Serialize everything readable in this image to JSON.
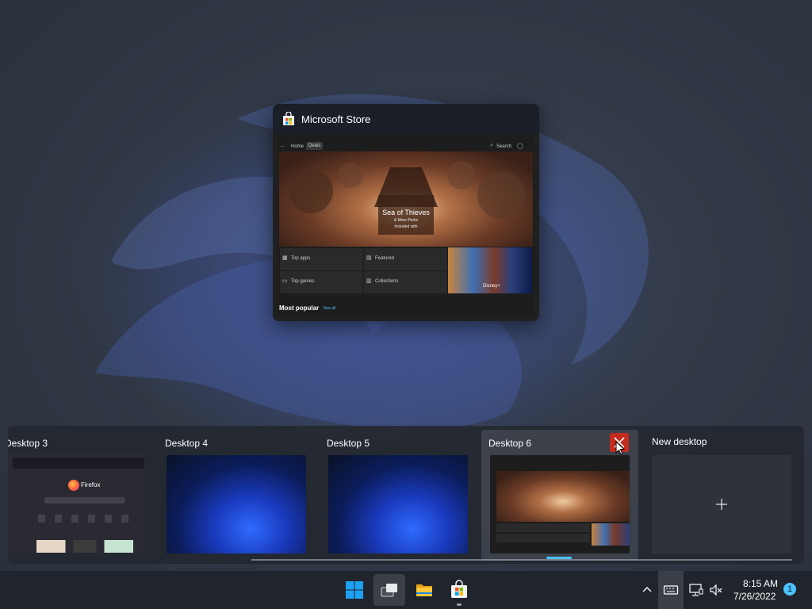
{
  "window": {
    "title": "Microsoft Store",
    "app_icon": "store-bag-icon",
    "preview": {
      "nav_home": "Home",
      "nav_deals": "Deals",
      "search": "Search",
      "hero_title": "Sea of Thieves",
      "hero_subtitle": "& More Perks",
      "hero_note": "Included with",
      "tiles": [
        "Top apps",
        "Featured",
        "Top games",
        "Collections"
      ],
      "promo_label": "Disney+",
      "section_title": "Most popular",
      "section_link": "See all"
    }
  },
  "desktops": {
    "items": [
      {
        "label": "Desktop 3",
        "thumb": "firefox-window",
        "app_title": "Firefox"
      },
      {
        "label": "Desktop 4",
        "thumb": "wallpaper"
      },
      {
        "label": "Desktop 5",
        "thumb": "wallpaper"
      },
      {
        "label": "Desktop 6",
        "thumb": "store-window",
        "active": true
      }
    ],
    "new_desktop_label": "New desktop",
    "new_desktop_icon": "plus-icon",
    "close_icon": "close-icon"
  },
  "taskbar": {
    "apps": [
      {
        "name": "start",
        "icon": "windows-logo-icon"
      },
      {
        "name": "task-view",
        "icon": "task-view-icon"
      },
      {
        "name": "file-explorer",
        "icon": "folder-icon"
      },
      {
        "name": "microsoft-store",
        "icon": "store-bag-icon"
      }
    ],
    "tray": {
      "time": "8:15 AM",
      "date": "7/26/2022",
      "notification_count": "1",
      "icons": [
        "chevron-up-icon",
        "keyboard-icon",
        "network-icon",
        "volume-muted-icon"
      ]
    }
  },
  "colors": {
    "accent": "#4cc2ff",
    "close_red": "#c42b1c",
    "taskbar_bg": "#20242c",
    "windows_blue": "#1ea1f1"
  }
}
